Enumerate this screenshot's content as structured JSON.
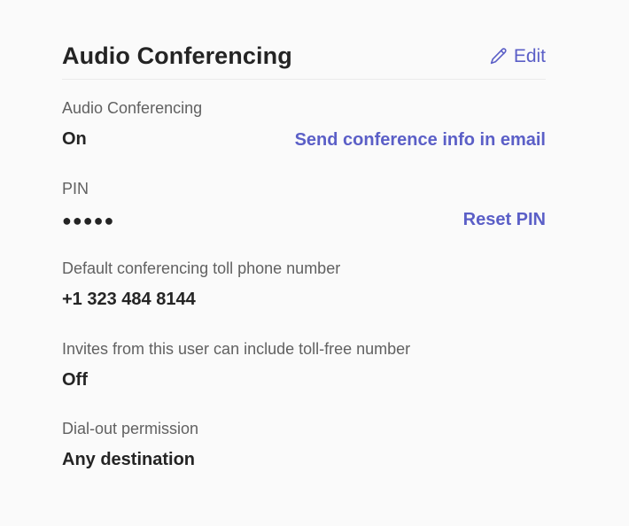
{
  "section": {
    "title": "Audio Conferencing",
    "edit_label": "Edit",
    "accent_color": "#5b5fc7"
  },
  "fields": {
    "audio_conferencing": {
      "label": "Audio Conferencing",
      "value": "On",
      "action": "Send conference info in email"
    },
    "pin": {
      "label": "PIN",
      "value": "●●●●●",
      "action": "Reset PIN"
    },
    "toll_number": {
      "label": "Default conferencing toll phone number",
      "value": "+1 323 484 8144"
    },
    "toll_free": {
      "label": "Invites from this user can include toll-free number",
      "value": "Off"
    },
    "dial_out": {
      "label": "Dial-out permission",
      "value": "Any destination"
    }
  }
}
